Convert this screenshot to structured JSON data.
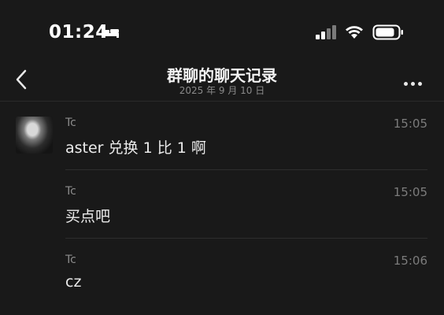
{
  "status_bar": {
    "time": "01:24",
    "icons": [
      "bed-icon",
      "signal-icon",
      "wifi-icon",
      "battery-icon"
    ]
  },
  "nav": {
    "title": "群聊的聊天记录",
    "subtitle": "2025 年 9 月 10 日",
    "back_icon": "chevron-left-icon",
    "more_icon": "ellipsis-icon"
  },
  "messages": [
    {
      "sender": "Tc",
      "time": "15:05",
      "text": "aster 兑换 1 比 1 啊",
      "has_avatar": true
    },
    {
      "sender": "Tc",
      "time": "15:05",
      "text": "买点吧",
      "has_avatar": false
    },
    {
      "sender": "Tc",
      "time": "15:06",
      "text": "cz",
      "has_avatar": false
    }
  ],
  "colors": {
    "background": "#191919",
    "text_primary": "#ececec",
    "text_secondary": "#8c8c8c"
  }
}
